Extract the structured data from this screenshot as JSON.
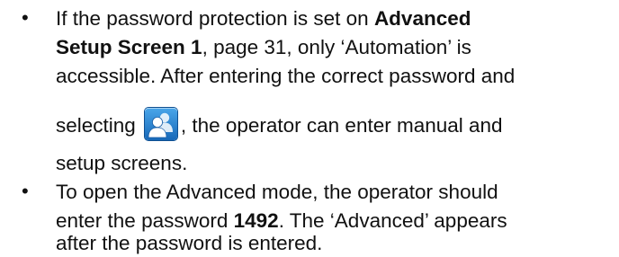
{
  "bullets": [
    {
      "symbol": "•",
      "line1_a": "If the password protection is set on ",
      "line1_b": "Advanced",
      "line2_a": "Setup Screen 1",
      "line2_b": ", page 31, only ‘Automation’ is",
      "line3": "accessible. After entering the correct password and",
      "line4_a": "selecting",
      "icon": "user-icon",
      "line4_b": ", the operator can enter manual and",
      "line5": "setup screens."
    },
    {
      "symbol": "•",
      "line1": "To open the Advanced mode, the operator should",
      "line2_a": "enter the password ",
      "line2_b": "1492",
      "line2_c": ". The ‘Advanced’ appears",
      "line3": "after the password is entered."
    }
  ],
  "colors": {
    "text": "#111111",
    "icon_bg_top": "#4aa6ea",
    "icon_bg_bottom": "#1768b8"
  }
}
